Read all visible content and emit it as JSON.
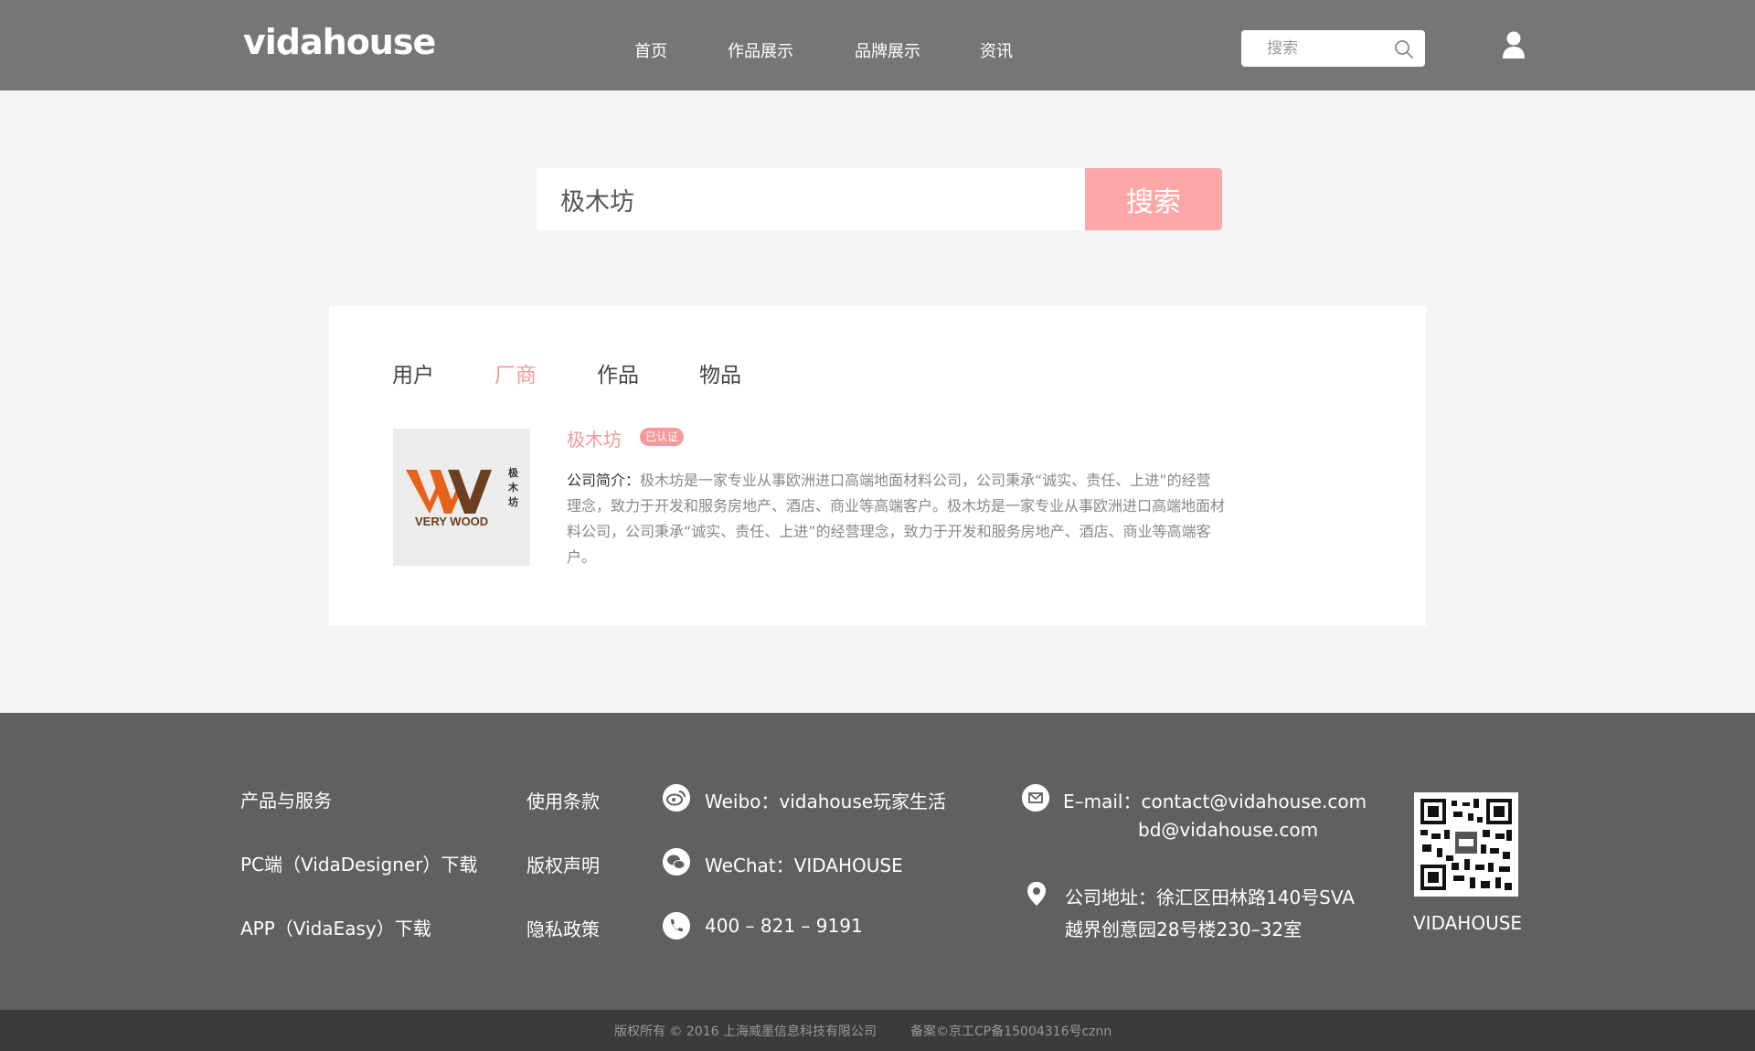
{
  "header": {
    "logo": "vidahouse",
    "nav": [
      "首页",
      "作品展示",
      "品牌展示",
      "资讯"
    ],
    "search_placeholder": "搜索",
    "icons": {
      "search": "search-icon",
      "user": "user-icon"
    }
  },
  "main_search": {
    "value": "极木坊",
    "button": "搜索"
  },
  "results": {
    "tabs": [
      "用户",
      "厂商",
      "作品",
      "物品"
    ],
    "active_tab": "厂商",
    "item": {
      "title": "极木坊",
      "badge": "已认证",
      "logo_text_en": "VERY WOOD",
      "logo_text_cn": "极木坊",
      "desc_label": "公司简介：",
      "desc": "极木坊是一家专业从事欧洲进口高端地面材料公司，公司秉承“诚实、责任、上进”的经营理念，致力于开发和服务房地产、酒店、商业等高端客户。极木坊是一家专业从事欧洲进口高端地面材料公司，公司秉承“诚实、责任、上进”的经营理念，致力于开发和服务房地产、酒店、商业等高端客户。"
    }
  },
  "footer": {
    "col1": [
      "产品与服务",
      "PC端（VidaDesigner）下载",
      "APP（VidaEasy）下载"
    ],
    "col2": [
      "使用条款",
      "版权声明",
      "隐私政策"
    ],
    "weibo": "Weibo：vidahouse玩家生活",
    "wechat": "WeChat：VIDAHOUSE",
    "phone": "400 – 821 – 9191",
    "email1": "E–mail：contact@vidahouse.com",
    "email2": "bd@vidahouse.com",
    "address1": "公司地址：徐汇区田林路140号SVA",
    "address2": "越界创意园28号楼230–32室",
    "qr_label": "VIDAHOUSE",
    "copyright": "版权所有 © 2016 上海威墨信息科技有限公司",
    "icp": "备案©京工CP备15004316号cznn"
  },
  "colors": {
    "header_bg": "#767676",
    "accent": "#f59a9a",
    "search_button": "#fda7a7",
    "footer_bg": "#606060",
    "bottom_bar": "#3b3b3b"
  }
}
